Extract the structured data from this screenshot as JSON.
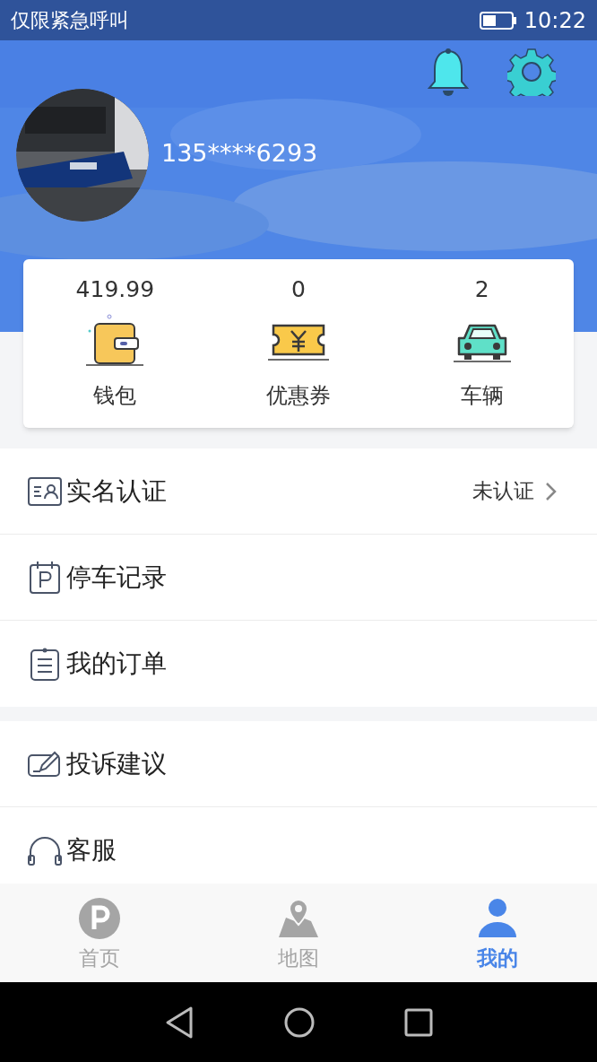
{
  "status_bar": {
    "notice": "仅限紧急呼叫",
    "time": "10:22"
  },
  "profile": {
    "phone": "135****6293"
  },
  "stats": [
    {
      "kind": "wallet",
      "value": "419.99",
      "label": "钱包"
    },
    {
      "kind": "coupon",
      "value": "0",
      "label": "优惠券"
    },
    {
      "kind": "car",
      "value": "2",
      "label": "车辆"
    }
  ],
  "menu_groups": [
    [
      {
        "kind": "id",
        "label": "实名认证",
        "status": "未认证"
      },
      {
        "kind": "parking",
        "label": "停车记录"
      },
      {
        "kind": "order",
        "label": "我的订单"
      }
    ],
    [
      {
        "kind": "feedback",
        "label": "投诉建议"
      },
      {
        "kind": "service",
        "label": "客服"
      }
    ]
  ],
  "tabs": [
    {
      "kind": "home",
      "label": "首页",
      "selected": false
    },
    {
      "kind": "map",
      "label": "地图",
      "selected": false
    },
    {
      "kind": "me",
      "label": "我的",
      "selected": true
    }
  ]
}
